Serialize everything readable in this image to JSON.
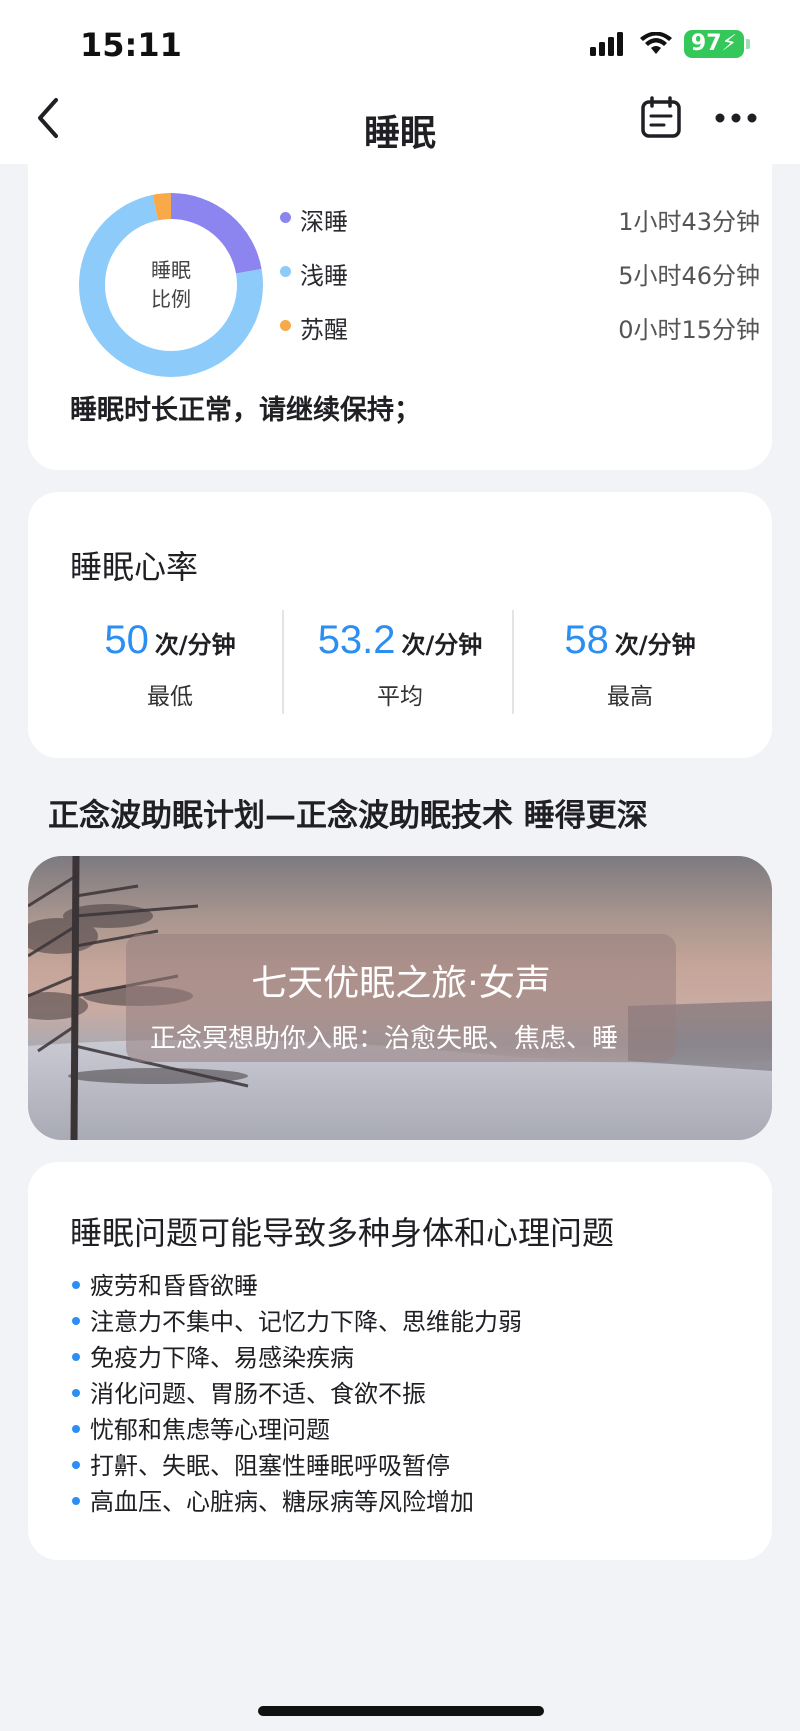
{
  "status_bar": {
    "time": "15:11",
    "battery": "97"
  },
  "nav": {
    "title": "睡眠"
  },
  "sleep_ratio": {
    "center_line1": "睡眠",
    "center_line2": "比例",
    "segments": [
      {
        "label": "深睡",
        "value": "1小时43分钟",
        "minutes": 103,
        "color": "#8c85f0"
      },
      {
        "label": "浅睡",
        "value": "5小时46分钟",
        "minutes": 346,
        "color": "#8ccbfa"
      },
      {
        "label": "苏醒",
        "value": "0小时15分钟",
        "minutes": 15,
        "color": "#f8a94a"
      }
    ],
    "summary": "睡眠时长正常，请继续保持；"
  },
  "heart_rate": {
    "title": "睡眠心率",
    "unit": "次/分钟",
    "stats": [
      {
        "value": "50",
        "label": "最低"
      },
      {
        "value": "53.2",
        "label": "平均"
      },
      {
        "value": "58",
        "label": "最高"
      }
    ]
  },
  "plan": {
    "title": "正念波助眠计划—正念波助眠技术 睡得更深",
    "banner_title": "七天优眠之旅·女声",
    "banner_subtitle": "正念冥想助你入眠：治愈失眠、焦虑、睡"
  },
  "issues": {
    "title": "睡眠问题可能导致多种身体和心理问题",
    "items": [
      "疲劳和昏昏欲睡",
      "注意力不集中、记忆力下降、思维能力弱",
      "免疫力下降、易感染疾病",
      "消化问题、胃肠不适、食欲不振",
      "忧郁和焦虑等心理问题",
      "打鼾、失眠、阻塞性睡眠呼吸暂停",
      "高血压、心脏病、糖尿病等风险增加"
    ]
  },
  "colors": {
    "accent": "#2b8ef3",
    "background": "#f2f3f7",
    "card": "#ffffff"
  },
  "icons": [
    "signal-icon",
    "wifi-icon",
    "battery-icon",
    "back-chevron-icon",
    "calendar-icon",
    "more-icon"
  ]
}
